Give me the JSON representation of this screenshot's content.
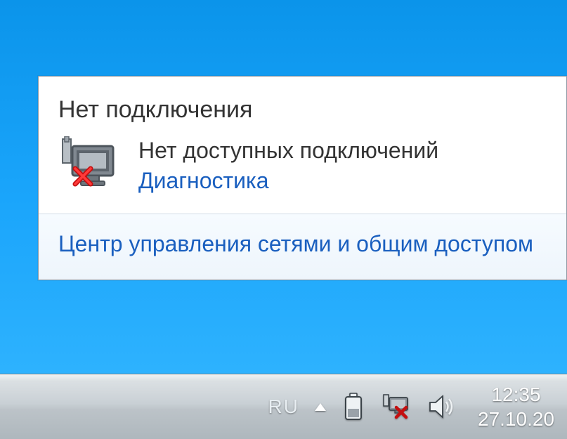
{
  "popup": {
    "title": "Нет подключения",
    "message": "Нет доступных подключений",
    "diagnose_link": "Диагностика",
    "footer_link": "Центр управления сетями и общим доступом"
  },
  "tray": {
    "language": "RU",
    "time": "12:35",
    "date": "27.10.20"
  },
  "icons": {
    "network_disconnected": "network-disconnected-icon",
    "show_hidden": "show-hidden-icons",
    "battery": "battery-icon",
    "network_tray": "network-tray-icon",
    "volume": "volume-icon"
  }
}
